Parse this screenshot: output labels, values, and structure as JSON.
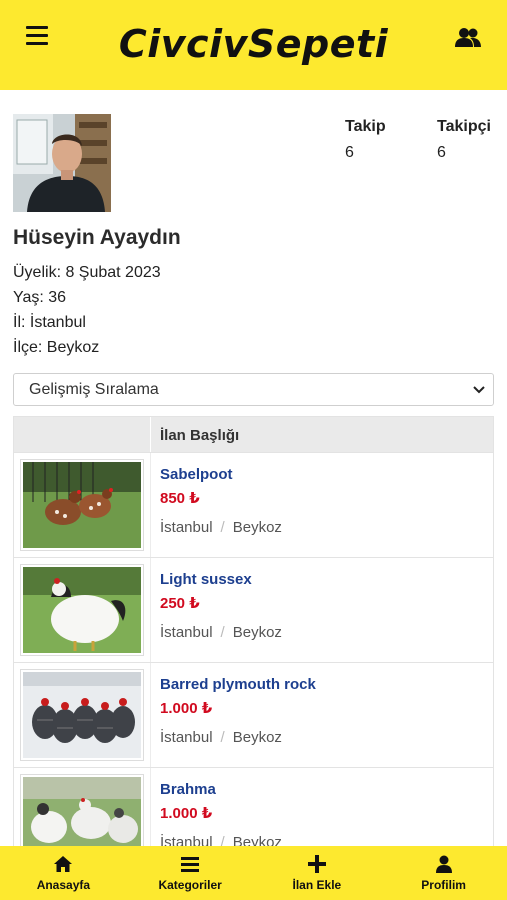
{
  "header": {
    "brand": "CivcivSepeti",
    "menu_icon": "hamburger-menu-icon",
    "users_icon": "users-icon"
  },
  "profile": {
    "name": "Hüseyin Ayaydın",
    "membership": "Üyelik: 8 Şubat 2023",
    "age": "Yaş: 36",
    "city": "İl: İstanbul",
    "district": "İlçe: Beykoz",
    "stats": {
      "following_label": "Takip",
      "following_value": "6",
      "followers_label": "Takipçi",
      "followers_value": "6"
    }
  },
  "sort": {
    "selected": "Gelişmiş Sıralama"
  },
  "table": {
    "header": "İlan Başlığı",
    "rows": [
      {
        "title": "Sabelpoot",
        "price": "850 ₺",
        "city": "İstanbul",
        "district": "Beykoz"
      },
      {
        "title": "Light sussex",
        "price": "250 ₺",
        "city": "İstanbul",
        "district": "Beykoz"
      },
      {
        "title": "Barred plymouth rock",
        "price": "1.000 ₺",
        "city": "İstanbul",
        "district": "Beykoz"
      },
      {
        "title": "Brahma",
        "price": "1.000 ₺",
        "city": "İstanbul",
        "district": "Beykoz"
      }
    ]
  },
  "bottom_nav": [
    {
      "label": "Anasayfa",
      "icon": "home-icon"
    },
    {
      "label": "Kategoriler",
      "icon": "list-icon"
    },
    {
      "label": "İlan Ekle",
      "icon": "plus-icon"
    },
    {
      "label": "Profilim",
      "icon": "user-icon"
    }
  ],
  "colors": {
    "brand_yellow": "#fde92f",
    "title_blue": "#1d3f8f",
    "price_red": "#d10a1f"
  }
}
